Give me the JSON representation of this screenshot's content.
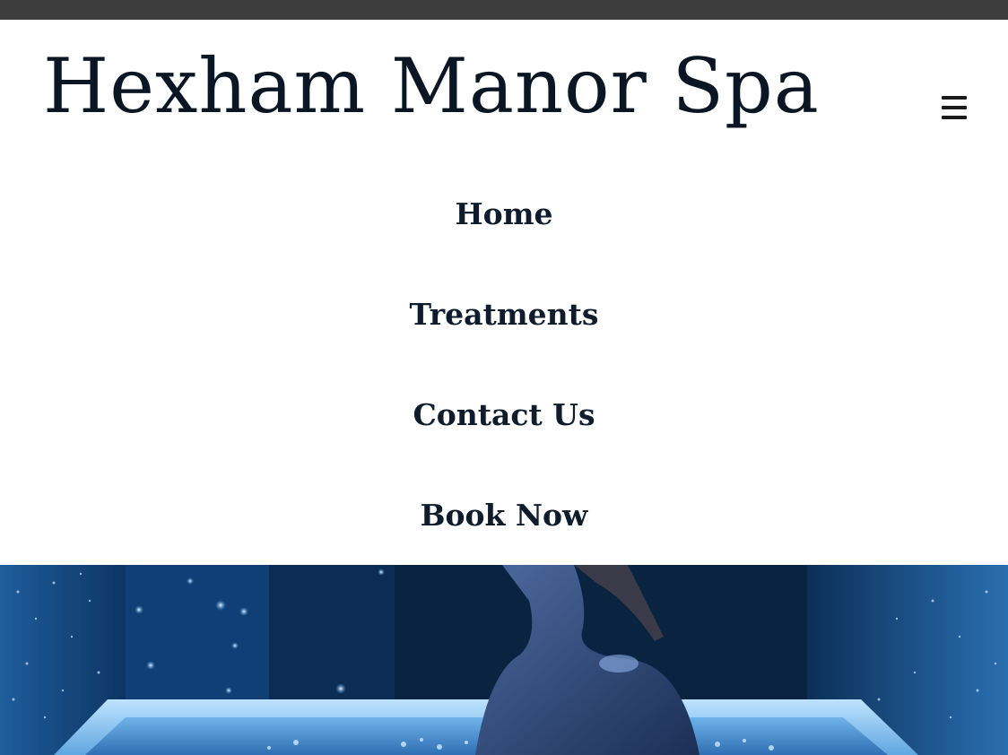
{
  "site": {
    "title": "Hexham Manor Spa"
  },
  "header": {
    "menu_icon": "hamburger-menu-icon"
  },
  "nav": {
    "items": [
      {
        "label": "Home"
      },
      {
        "label": "Treatments"
      },
      {
        "label": "Contact Us"
      },
      {
        "label": "Book Now"
      }
    ]
  },
  "hero": {
    "image_description_icon": "spa-hot-tub-photo"
  },
  "colors": {
    "topbar": "#3d3d3d",
    "title_text": "#0b1624",
    "nav_text": "#0f1c2b",
    "background": "#ffffff",
    "hero_blue": "#1c5a9c"
  }
}
